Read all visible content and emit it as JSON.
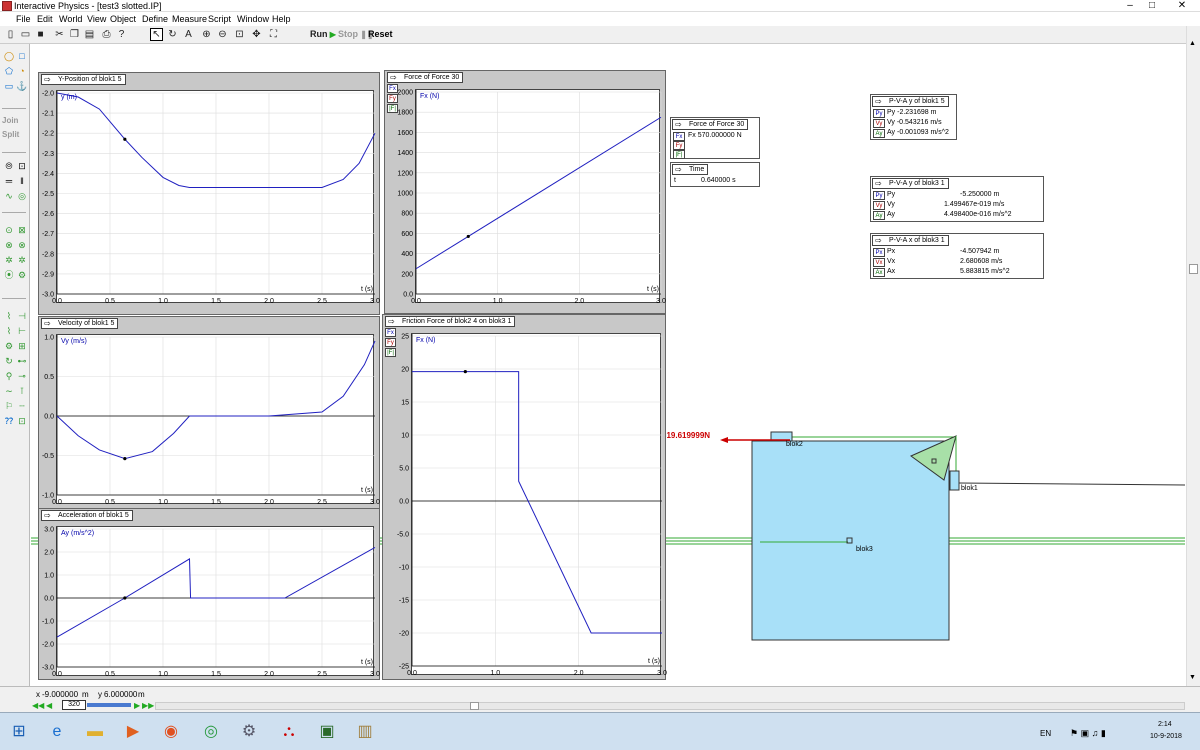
{
  "window": {
    "title": "Interactive Physics - [test3 slotted.IP]",
    "min": "–",
    "max": "□",
    "close": "✕"
  },
  "menu": [
    "File",
    "Edit",
    "World",
    "View",
    "Object",
    "Define",
    "Measure",
    "Script",
    "Window",
    "Help"
  ],
  "toolbar": {
    "run": "Run",
    "stop": "Stop",
    "reset": "Reset"
  },
  "palette": {
    "join": "Join",
    "split": "Split"
  },
  "graph_y": {
    "title": "Y-Position of blok1 5",
    "label": "y (m)",
    "xlabel": "t (s)"
  },
  "graph_v": {
    "title": "Velocity of blok1 5",
    "label": "Vy (m/s)",
    "xlabel": "t (s)"
  },
  "graph_a": {
    "title": "Acceleration of blok1 5",
    "label": "Ay (m/s^2)",
    "xlabel": "t (s)"
  },
  "graph_f": {
    "title": "Force of Force 30",
    "label": "Fx (N)",
    "xlabel": "t (s)",
    "btns": [
      "Fx",
      "Fy",
      "|F|"
    ]
  },
  "graph_fr": {
    "title": "Friction Force of blok2 4 on blok3 1",
    "label": "Fx (N)",
    "xlabel": "t (s)",
    "btns": [
      "Fx",
      "Fy",
      "|F|"
    ]
  },
  "meter_force": {
    "title": "Force of Force 30",
    "btns": [
      "Fx",
      "Fy",
      "|F|"
    ],
    "value": "Fx 570.000000 N"
  },
  "meter_time": {
    "title": "Time",
    "label": "t",
    "value": "0.640000 s"
  },
  "meter_pva1": {
    "title": "P-V-A y of blok1 5",
    "btns": [
      "Py",
      "Vy",
      "Ay"
    ],
    "rows": [
      "Py   -2.231698 m",
      "Vy   -0.543216 m/s",
      "Ay   -0.001093 m/s^2"
    ]
  },
  "meter_pva3y": {
    "title": "P-V-A y of blok3 1",
    "btns": [
      "Py",
      "Vy",
      "Ay"
    ],
    "labels": [
      "Py",
      "Vy",
      "Ay"
    ],
    "values": [
      "-5.250000 m",
      "1.499467e-019 m/s",
      "4.498400e-016 m/s^2"
    ]
  },
  "meter_pva3x": {
    "title": "P-V-A x of blok3 1",
    "btns": [
      "Px",
      "Vx",
      "Ax"
    ],
    "labels": [
      "Px",
      "Vx",
      "Ax"
    ],
    "values": [
      "-4.507942 m",
      "2.680608 m/s",
      "5.883815 m/s^2"
    ]
  },
  "scene": {
    "ff_label": "FF=19.619999N",
    "blok1": "blok1",
    "blok2": "blok2",
    "blok3": "blok3"
  },
  "status": {
    "x_label": "x",
    "x_value": "-9.000000",
    "x_unit": "m",
    "y_label": "y",
    "y_value": "6.000000",
    "y_unit": "m",
    "frame": "320"
  },
  "tray": {
    "lang": "EN",
    "time": "2:14",
    "date": "10-9-2018"
  },
  "colors": {
    "plot_line": "#2020c0",
    "window_bg": "#c8c8c8",
    "body": "#a8e0f8",
    "green": "#33aa33",
    "red": "#cc0000"
  },
  "chart_data": [
    {
      "type": "line",
      "title": "Y-Position of blok1 5",
      "xlabel": "t (s)",
      "ylabel": "y (m)",
      "xlim": [
        0,
        3
      ],
      "ylim": [
        -3,
        -2
      ],
      "xticks": [
        "0.0",
        "0.5",
        "1.0",
        "1.5",
        "2.0",
        "2.5",
        "3.0"
      ],
      "yticks": [
        "-2.0",
        "-2.1",
        "-2.2",
        "-2.3",
        "-2.4",
        "-2.5",
        "-2.6",
        "-2.7",
        "-2.8",
        "-2.9",
        "-3.0"
      ],
      "x": [
        0,
        0.2,
        0.4,
        0.64,
        0.8,
        1.0,
        1.15,
        1.25,
        1.5,
        2.0,
        2.5,
        2.7,
        2.85,
        3.0
      ],
      "y": [
        -2.0,
        -2.02,
        -2.08,
        -2.23,
        -2.32,
        -2.42,
        -2.46,
        -2.47,
        -2.47,
        -2.47,
        -2.47,
        -2.43,
        -2.35,
        -2.2
      ],
      "marker": {
        "x": 0.64,
        "y": -2.23
      }
    },
    {
      "type": "line",
      "title": "Force of Force 30",
      "xlabel": "t (s)",
      "ylabel": "Fx (N)",
      "xlim": [
        0,
        3
      ],
      "ylim": [
        0,
        2000
      ],
      "xticks": [
        "0.0",
        "1.0",
        "2.0",
        "3.0"
      ],
      "yticks": [
        "0.0",
        "200",
        "400",
        "600",
        "800",
        "1000",
        "1200",
        "1400",
        "1600",
        "1800",
        "2000"
      ],
      "x": [
        0,
        3
      ],
      "y": [
        250,
        1750
      ],
      "marker": {
        "x": 0.64,
        "y": 570
      }
    },
    {
      "type": "line",
      "title": "Velocity of blok1 5",
      "xlabel": "t (s)",
      "ylabel": "Vy (m/s)",
      "xlim": [
        0,
        3
      ],
      "ylim": [
        -1,
        1
      ],
      "xticks": [
        "0.0",
        "0.5",
        "1.0",
        "1.5",
        "2.0",
        "2.5",
        "3.0"
      ],
      "yticks": [
        "1.0",
        "0.5",
        "0.0",
        "-0.5",
        "-1.0"
      ],
      "x": [
        0,
        0.2,
        0.4,
        0.64,
        0.9,
        1.1,
        1.25,
        1.5,
        2.0,
        2.5,
        2.7,
        2.9,
        3.0
      ],
      "y": [
        0,
        -0.25,
        -0.43,
        -0.54,
        -0.45,
        -0.22,
        0,
        0,
        0,
        0.05,
        0.25,
        0.65,
        0.95
      ],
      "marker": {
        "x": 0.64,
        "y": -0.54
      }
    },
    {
      "type": "line",
      "title": "Acceleration of blok1 5",
      "xlabel": "t (s)",
      "ylabel": "Ay (m/s^2)",
      "xlim": [
        0,
        3
      ],
      "ylim": [
        -3,
        3
      ],
      "xticks": [
        "0.0",
        "0.5",
        "1.0",
        "1.5",
        "2.0",
        "2.5",
        "3.0"
      ],
      "yticks": [
        "3.0",
        "2.0",
        "1.0",
        "0.0",
        "-1.0",
        "-2.0",
        "-3.0"
      ],
      "x": [
        0,
        0.64,
        1.25,
        1.26,
        2.15,
        3.0
      ],
      "y": [
        -1.7,
        0,
        1.7,
        0,
        0,
        2.2
      ],
      "marker": {
        "x": 0.64,
        "y": 0
      }
    },
    {
      "type": "line",
      "title": "Friction Force of blok2 4 on blok3 1",
      "xlabel": "t (s)",
      "ylabel": "Fx (N)",
      "xlim": [
        0,
        3
      ],
      "ylim": [
        -25,
        25
      ],
      "xticks": [
        "0.0",
        "1.0",
        "2.0",
        "3.0"
      ],
      "yticks": [
        "25",
        "20",
        "15",
        "10",
        "5.0",
        "0.0",
        "-5.0",
        "-10",
        "-15",
        "-20",
        "-25"
      ],
      "x": [
        0,
        1.28,
        1.28,
        2.15,
        3.0
      ],
      "y": [
        19.6,
        19.6,
        3,
        -20,
        -20
      ],
      "marker": {
        "x": 0.64,
        "y": 19.6
      }
    }
  ]
}
